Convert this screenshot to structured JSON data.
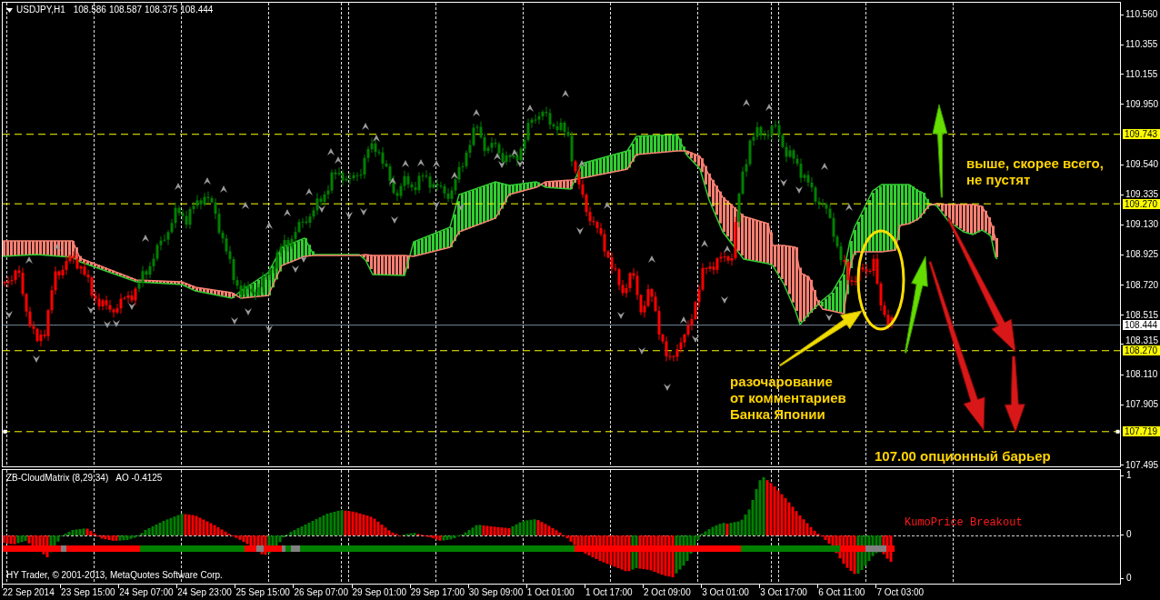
{
  "chart": {
    "symbol": "USDJPY,H1",
    "quotes": [
      "108.586",
      "108.587",
      "108.375",
      "108.444"
    ],
    "price_ticks": [
      "110.560",
      "110.355",
      "110.155",
      "109.950",
      "109.540",
      "109.335",
      "109.130",
      "108.925",
      "108.720",
      "108.515",
      "108.315",
      "108.110",
      "107.905",
      "107.495"
    ],
    "price_lines": [
      {
        "label": "109.743",
        "kind": "level",
        "selected": false
      },
      {
        "label": "109.270",
        "kind": "level",
        "selected": false
      },
      {
        "label": "108.444",
        "kind": "bid",
        "selected": false
      },
      {
        "label": "108.270",
        "kind": "level",
        "selected": false
      },
      {
        "label": "107.719",
        "kind": "level",
        "selected": true
      }
    ],
    "annotations": [
      {
        "lines": [
          "выше, скорее всего,",
          "не пустят"
        ]
      },
      {
        "lines": [
          "разочарование",
          "от комментариев",
          "Банка Японии"
        ]
      },
      {
        "lines": [
          "107.00 опционный барьер"
        ]
      }
    ]
  },
  "indicator": {
    "title": "ZB-CloudMatrix (8,29,34)",
    "reading": "AO -0.4125",
    "signal": "KumoPrice Breakout",
    "copyright": "HY Trader, © 2001-2013, MetaQuotes Software Corp.",
    "scale": [
      "1",
      "0",
      "0"
    ]
  },
  "time_axis": [
    "22 Sep 2014",
    "23 Sep 15:00",
    "24 Sep 07:00",
    "24 Sep 23:00",
    "25 Sep 15:00",
    "26 Sep 07:00",
    "29 Sep 01:00",
    "29 Sep 17:00",
    "30 Sep 09:00",
    "1 Oct 01:00",
    "1 Oct 17:00",
    "2 Oct 09:00",
    "3 Oct 01:00",
    "3 Oct 17:00",
    "6 Oct 11:00",
    "7 Oct 03:00"
  ]
}
